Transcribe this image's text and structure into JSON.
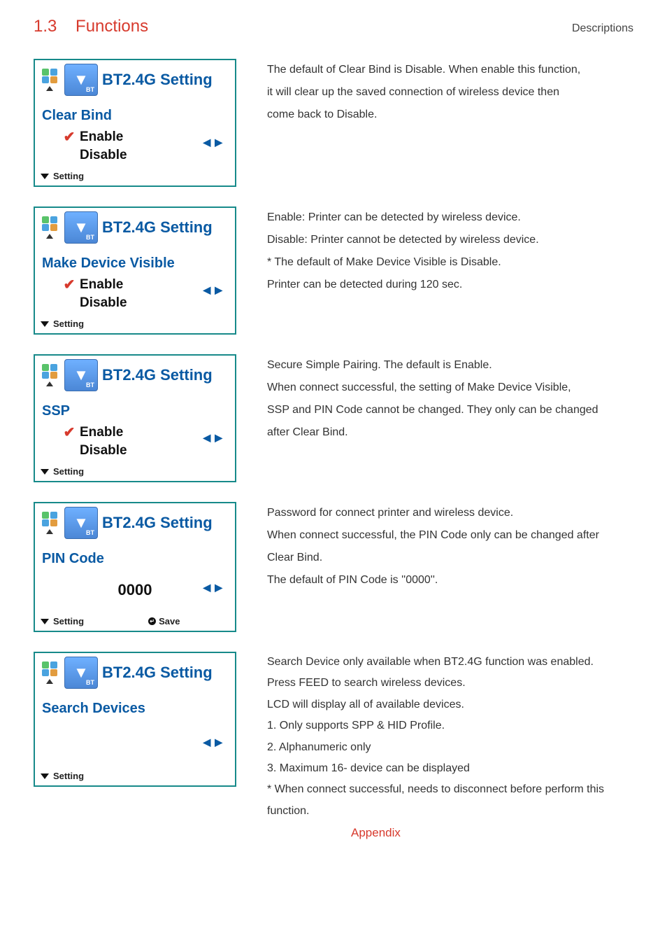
{
  "page": {
    "section_number": "1.3",
    "section_title": "Functions",
    "descriptions_label": "Descriptions",
    "appendix_label": "Appendix"
  },
  "common": {
    "header_title": "BT2.4G Setting",
    "bt_badge": "BT",
    "footer_setting": "Setting",
    "footer_save": "Save",
    "option_enable": "Enable",
    "option_disable": "Disable",
    "nav_left": "◀",
    "nav_right": "▶"
  },
  "panels": [
    {
      "id": "clear-bind",
      "topic": "Clear Bind",
      "selected": "Enable",
      "options": [
        "Enable",
        "Disable"
      ],
      "show_save": false,
      "desc": [
        "The default of Clear Bind is Disable. When enable this function,",
        "it will clear up the saved connection of wireless device then",
        "come back to Disable."
      ]
    },
    {
      "id": "make-device-visible",
      "topic": "Make Device Visible",
      "selected": "Enable",
      "options": [
        "Enable",
        "Disable"
      ],
      "show_save": false,
      "desc": [
        "Enable: Printer can be detected by wireless device.",
        "Disable: Printer cannot be detected by wireless device.",
        "* The default of Make Device Visible is Disable.",
        "   Printer can be detected during 120 sec."
      ]
    },
    {
      "id": "ssp",
      "topic": "SSP",
      "selected": "Enable",
      "options": [
        "Enable",
        "Disable"
      ],
      "show_save": false,
      "desc": [
        "Secure Simple Pairing. The default is Enable.",
        "When connect successful, the setting of Make Device Visible,",
        "SSP and PIN Code cannot be changed. They only can be changed",
        "after Clear Bind."
      ]
    },
    {
      "id": "pin-code",
      "topic": "PIN Code",
      "value": "0000",
      "options": [],
      "show_save": true,
      "desc": [
        "Password for connect printer and wireless device.",
        "When connect successful, the PIN Code only can be changed after",
        "Clear Bind.",
        "The default of PIN Code is ''0000''."
      ]
    },
    {
      "id": "search-devices",
      "topic": "Search Devices",
      "options": [],
      "show_save": false,
      "desc": [
        "Search Device only available when BT2.4G function was enabled.",
        "Press FEED to search wireless devices.",
        "LCD will display all of available devices.",
        "1. Only supports SPP & HID Profile.",
        "2. Alphanumeric only",
        "3. Maximum 16- device can be displayed",
        "* When connect successful, needs to disconnect before perform this function."
      ]
    }
  ]
}
